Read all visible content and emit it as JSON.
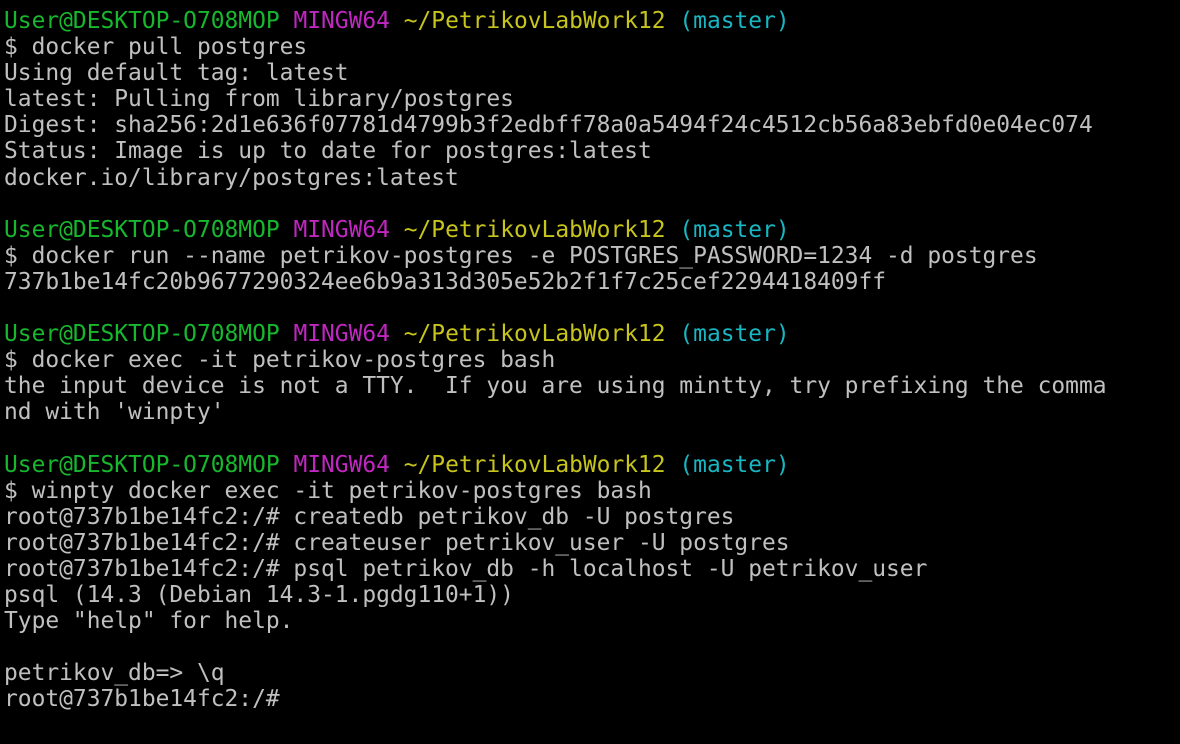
{
  "colors": {
    "background": "#000000",
    "text": "#c0c0c0",
    "user_host": "#17b82e",
    "mingw": "#c027c0",
    "path": "#c7c41c",
    "branch": "#18b6c2"
  },
  "lines": [
    [
      {
        "t": "User@DESKTOP-O708MOP",
        "c": "user_host"
      },
      {
        "t": " "
      },
      {
        "t": "MINGW64",
        "c": "mingw"
      },
      {
        "t": " "
      },
      {
        "t": "~/PetrikovLabWork12",
        "c": "path"
      },
      {
        "t": " "
      },
      {
        "t": "(master)",
        "c": "branch"
      }
    ],
    [
      {
        "t": "$ docker pull postgres"
      }
    ],
    [
      {
        "t": "Using default tag: latest"
      }
    ],
    [
      {
        "t": "latest: Pulling from library/postgres"
      }
    ],
    [
      {
        "t": "Digest: sha256:2d1e636f07781d4799b3f2edbff78a0a5494f24c4512cb56a83ebfd0e04ec074"
      }
    ],
    [
      {
        "t": "Status: Image is up to date for postgres:latest"
      }
    ],
    [
      {
        "t": "docker.io/library/postgres:latest"
      }
    ],
    [],
    [
      {
        "t": "User@DESKTOP-O708MOP",
        "c": "user_host"
      },
      {
        "t": " "
      },
      {
        "t": "MINGW64",
        "c": "mingw"
      },
      {
        "t": " "
      },
      {
        "t": "~/PetrikovLabWork12",
        "c": "path"
      },
      {
        "t": " "
      },
      {
        "t": "(master)",
        "c": "branch"
      }
    ],
    [
      {
        "t": "$ docker run --name petrikov-postgres -e POSTGRES_PASSWORD=1234 -d postgres"
      }
    ],
    [
      {
        "t": "737b1be14fc20b9677290324ee6b9a313d305e52b2f1f7c25cef2294418409ff"
      }
    ],
    [],
    [
      {
        "t": "User@DESKTOP-O708MOP",
        "c": "user_host"
      },
      {
        "t": " "
      },
      {
        "t": "MINGW64",
        "c": "mingw"
      },
      {
        "t": " "
      },
      {
        "t": "~/PetrikovLabWork12",
        "c": "path"
      },
      {
        "t": " "
      },
      {
        "t": "(master)",
        "c": "branch"
      }
    ],
    [
      {
        "t": "$ docker exec -it petrikov-postgres bash"
      }
    ],
    [
      {
        "t": "the input device is not a TTY.  If you are using mintty, try prefixing the comma"
      }
    ],
    [
      {
        "t": "nd with 'winpty'"
      }
    ],
    [],
    [
      {
        "t": "User@DESKTOP-O708MOP",
        "c": "user_host"
      },
      {
        "t": " "
      },
      {
        "t": "MINGW64",
        "c": "mingw"
      },
      {
        "t": " "
      },
      {
        "t": "~/PetrikovLabWork12",
        "c": "path"
      },
      {
        "t": " "
      },
      {
        "t": "(master)",
        "c": "branch"
      }
    ],
    [
      {
        "t": "$ winpty docker exec -it petrikov-postgres bash"
      }
    ],
    [
      {
        "t": "root@737b1be14fc2:/# createdb petrikov_db -U postgres"
      }
    ],
    [
      {
        "t": "root@737b1be14fc2:/# createuser petrikov_user -U postgres"
      }
    ],
    [
      {
        "t": "root@737b1be14fc2:/# psql petrikov_db -h localhost -U petrikov_user"
      }
    ],
    [
      {
        "t": "psql (14.3 (Debian 14.3-1.pgdg110+1))"
      }
    ],
    [
      {
        "t": "Type \"help\" for help."
      }
    ],
    [],
    [
      {
        "t": "petrikov_db=> \\q"
      }
    ],
    [
      {
        "t": "root@737b1be14fc2:/#"
      }
    ]
  ]
}
